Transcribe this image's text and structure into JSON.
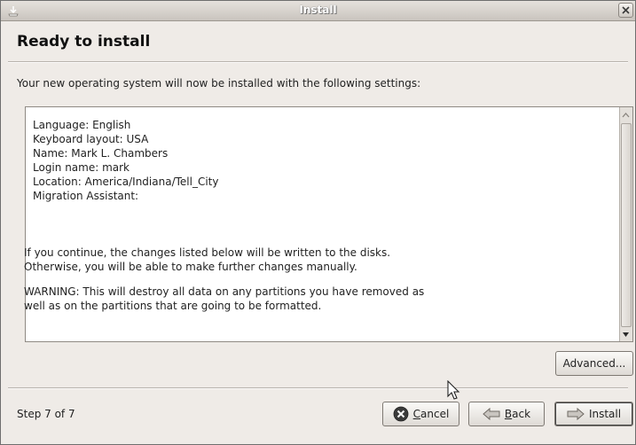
{
  "window": {
    "title": "Install"
  },
  "page": {
    "heading": "Ready to install",
    "intro": "Your new operating system will now be installed with the following settings:"
  },
  "summary": {
    "lines": [
      "Language: English",
      "Keyboard layout: USA",
      "Name: Mark L. Chambers",
      "Login name: mark",
      "Location: America/Indiana/Tell_City",
      "Migration Assistant:"
    ],
    "continue_line1": "If you continue, the changes listed below will be written to the disks.",
    "continue_line2": "Otherwise, you will be able to make further changes manually.",
    "warning_line1": "WARNING: This will destroy all data on any partitions you have removed as",
    "warning_line2": "well as on the partitions that are going to be formatted."
  },
  "buttons": {
    "advanced": "Advanced...",
    "cancel_label_rest": "ancel",
    "cancel_mnemonic": "C",
    "back_label_rest": "ack",
    "back_mnemonic": "B",
    "install": "Install"
  },
  "footer": {
    "step": "Step 7 of 7"
  },
  "icons": {
    "window_menu": "window-menu-icon",
    "close": "close-icon",
    "cancel": "cancel-icon",
    "back": "back-arrow-icon",
    "install": "forward-arrow-icon",
    "cursor": "mouse-pointer-icon"
  }
}
